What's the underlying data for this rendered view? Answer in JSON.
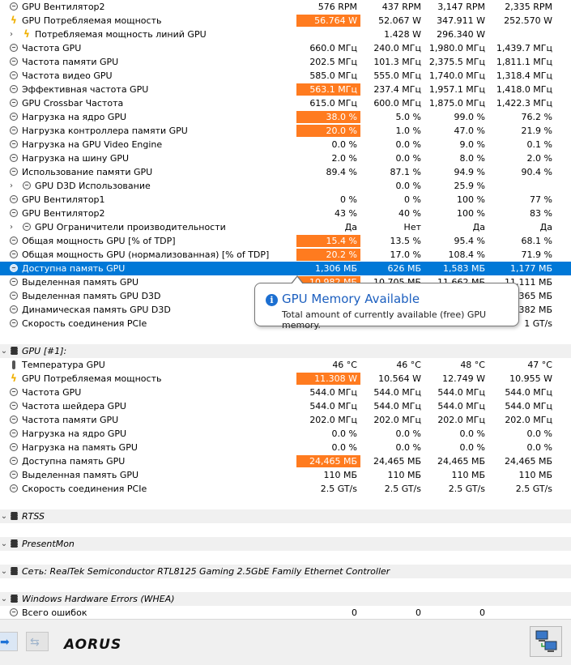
{
  "tooltip": {
    "title": "GPU Memory Available",
    "text": "Total amount of currently available (free) GPU memory."
  },
  "footer": {
    "logo": "AORUS",
    "forward_icon": "arrow-right-icon",
    "back_icon": "arrows-left-right-icon",
    "network_icon": "network-computers-icon"
  },
  "colors": {
    "highlight": "#ff7b1f",
    "selection": "#0078d7"
  },
  "rows": [
    {
      "type": "data",
      "icon": "clock",
      "label": "GPU Вентилятор2",
      "v": [
        "576 RPM",
        "437 RPM",
        "3,147 RPM",
        "2,335 RPM"
      ]
    },
    {
      "type": "data",
      "icon": "bolt",
      "label": "GPU Потребляемая мощность",
      "v": [
        "56.764 W",
        "52.067 W",
        "347.911 W",
        "252.570 W"
      ],
      "hl": true
    },
    {
      "type": "data",
      "icon": "bolt",
      "exp": true,
      "label": "Потребляемая мощность линий GPU",
      "v": [
        "",
        "1.428 W",
        "296.340 W",
        ""
      ]
    },
    {
      "type": "data",
      "icon": "clock",
      "label": "Частота GPU",
      "v": [
        "660.0 МГц",
        "240.0 МГц",
        "1,980.0 МГц",
        "1,439.7 МГц"
      ]
    },
    {
      "type": "data",
      "icon": "clock",
      "label": "Частота памяти GPU",
      "v": [
        "202.5 МГц",
        "101.3 МГц",
        "2,375.5 МГц",
        "1,811.1 МГц"
      ]
    },
    {
      "type": "data",
      "icon": "clock",
      "label": "Частота видео GPU",
      "v": [
        "585.0 МГц",
        "555.0 МГц",
        "1,740.0 МГц",
        "1,318.4 МГц"
      ]
    },
    {
      "type": "data",
      "icon": "clock",
      "label": "Эффективная частота GPU",
      "v": [
        "563.1 МГц",
        "237.4 МГц",
        "1,957.1 МГц",
        "1,418.0 МГц"
      ],
      "hl": true
    },
    {
      "type": "data",
      "icon": "clock",
      "label": "GPU Crossbar Частота",
      "v": [
        "615.0 МГц",
        "600.0 МГц",
        "1,875.0 МГц",
        "1,422.3 МГц"
      ]
    },
    {
      "type": "data",
      "icon": "clock",
      "label": "Нагрузка на ядро GPU",
      "v": [
        "38.0 %",
        "5.0 %",
        "99.0 %",
        "76.2 %"
      ],
      "hl": true
    },
    {
      "type": "data",
      "icon": "clock",
      "label": "Нагрузка контроллера памяти GPU",
      "v": [
        "20.0 %",
        "1.0 %",
        "47.0 %",
        "21.9 %"
      ],
      "hl": true
    },
    {
      "type": "data",
      "icon": "clock",
      "label": "Нагрузка на GPU Video Engine",
      "v": [
        "0.0 %",
        "0.0 %",
        "9.0 %",
        "0.1 %"
      ]
    },
    {
      "type": "data",
      "icon": "clock",
      "label": "Нагрузка на шину GPU",
      "v": [
        "2.0 %",
        "0.0 %",
        "8.0 %",
        "2.0 %"
      ]
    },
    {
      "type": "data",
      "icon": "clock",
      "label": "Использование памяти GPU",
      "v": [
        "89.4 %",
        "87.1 %",
        "94.9 %",
        "90.4 %"
      ]
    },
    {
      "type": "data",
      "icon": "clock",
      "exp": true,
      "label": "GPU D3D Использование",
      "v": [
        "",
        "0.0 %",
        "25.9 %",
        ""
      ]
    },
    {
      "type": "data",
      "icon": "clock",
      "label": "GPU Вентилятор1",
      "v": [
        "0 %",
        "0 %",
        "100 %",
        "77 %"
      ]
    },
    {
      "type": "data",
      "icon": "clock",
      "label": "GPU Вентилятор2",
      "v": [
        "43 %",
        "40 %",
        "100 %",
        "83 %"
      ]
    },
    {
      "type": "data",
      "icon": "clock",
      "exp": true,
      "label": "GPU Ограничители производительности",
      "v": [
        "Да",
        "Нет",
        "Да",
        "Да"
      ]
    },
    {
      "type": "data",
      "icon": "clock",
      "label": "Общая мощность GPU [% of TDP]",
      "v": [
        "15.4 %",
        "13.5 %",
        "95.4 %",
        "68.1 %"
      ],
      "hl": true
    },
    {
      "type": "data",
      "icon": "clock",
      "label": "Общая мощность GPU (нормализованная) [% of TDP]",
      "v": [
        "20.2 %",
        "17.0 %",
        "108.4 %",
        "71.9 %"
      ],
      "hl": true
    },
    {
      "type": "data",
      "icon": "clock",
      "label": "Доступна память GPU",
      "v": [
        "1,306 МБ",
        "626 МБ",
        "1,583 МБ",
        "1,177 МБ"
      ],
      "sel": true
    },
    {
      "type": "data",
      "icon": "clock",
      "label": "Выделенная память GPU",
      "v": [
        "10,982 МБ",
        "10,705 МБ",
        "11,662 МБ",
        "11,111 МБ"
      ],
      "hl": true
    },
    {
      "type": "data",
      "icon": "clock",
      "label": "Выделенная память GPU D3D",
      "v": [
        "",
        "",
        "",
        "365 МБ"
      ]
    },
    {
      "type": "data",
      "icon": "clock",
      "label": "Динамическая память GPU D3D",
      "v": [
        "",
        "",
        "",
        "382 МБ"
      ]
    },
    {
      "type": "data",
      "icon": "clock",
      "label": "Скорость соединения PCIe",
      "v": [
        "",
        "",
        "",
        "1 GT/s"
      ]
    },
    {
      "type": "blank"
    },
    {
      "type": "section",
      "label": "GPU [#1]:"
    },
    {
      "type": "data",
      "icon": "temp",
      "label": "Температура GPU",
      "v": [
        "46 °C",
        "46 °C",
        "48 °C",
        "47 °C"
      ]
    },
    {
      "type": "data",
      "icon": "bolt",
      "label": "GPU Потребляемая мощность",
      "v": [
        "11.308 W",
        "10.564 W",
        "12.749 W",
        "10.955 W"
      ],
      "hl": true
    },
    {
      "type": "data",
      "icon": "clock",
      "label": "Частота GPU",
      "v": [
        "544.0 МГц",
        "544.0 МГц",
        "544.0 МГц",
        "544.0 МГц"
      ]
    },
    {
      "type": "data",
      "icon": "clock",
      "label": "Частота шейдера GPU",
      "v": [
        "544.0 МГц",
        "544.0 МГц",
        "544.0 МГц",
        "544.0 МГц"
      ]
    },
    {
      "type": "data",
      "icon": "clock",
      "label": "Частота памяти GPU",
      "v": [
        "202.0 МГц",
        "202.0 МГц",
        "202.0 МГц",
        "202.0 МГц"
      ]
    },
    {
      "type": "data",
      "icon": "clock",
      "label": "Нагрузка на ядро GPU",
      "v": [
        "0.0 %",
        "0.0 %",
        "0.0 %",
        "0.0 %"
      ]
    },
    {
      "type": "data",
      "icon": "clock",
      "label": "Нагрузка на память GPU",
      "v": [
        "0.0 %",
        "0.0 %",
        "0.0 %",
        "0.0 %"
      ]
    },
    {
      "type": "data",
      "icon": "clock",
      "label": "Доступна память GPU",
      "v": [
        "24,465 МБ",
        "24,465 МБ",
        "24,465 МБ",
        "24,465 МБ"
      ],
      "hl": true
    },
    {
      "type": "data",
      "icon": "clock",
      "label": "Выделенная память GPU",
      "v": [
        "110 МБ",
        "110 МБ",
        "110 МБ",
        "110 МБ"
      ]
    },
    {
      "type": "data",
      "icon": "clock",
      "label": "Скорость соединения PCIe",
      "v": [
        "2.5 GT/s",
        "2.5 GT/s",
        "2.5 GT/s",
        "2.5 GT/s"
      ]
    },
    {
      "type": "blank"
    },
    {
      "type": "section",
      "label": "RTSS"
    },
    {
      "type": "blank"
    },
    {
      "type": "section",
      "label": "PresentMon"
    },
    {
      "type": "blank"
    },
    {
      "type": "section",
      "label": "Сеть: RealTek Semiconductor RTL8125 Gaming 2.5GbE Family Ethernet Controller"
    },
    {
      "type": "blank"
    },
    {
      "type": "section",
      "label": "Windows Hardware Errors (WHEA)"
    },
    {
      "type": "data",
      "icon": "clock",
      "label": "Всего ошибок",
      "v": [
        "0",
        "0",
        "0",
        ""
      ]
    }
  ]
}
